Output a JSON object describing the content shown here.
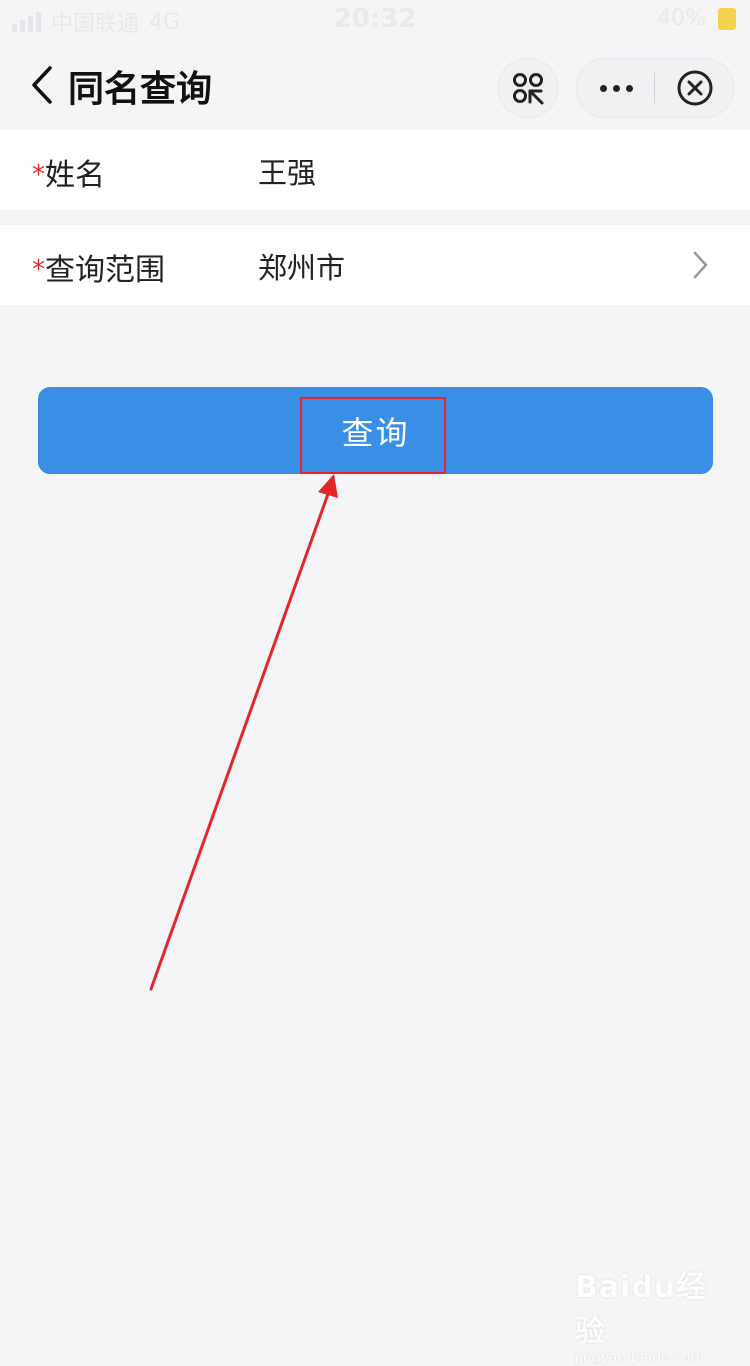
{
  "status_bar": {
    "carrier": "中国联通",
    "network": "4G",
    "time": "20:32",
    "battery": "40%"
  },
  "nav": {
    "title": "同名查询"
  },
  "form": {
    "required_mark": "*",
    "name_label": "姓名",
    "name_value": "王强",
    "range_label": "查询范围",
    "range_value": "郑州市"
  },
  "query_button": {
    "label": "查询"
  },
  "watermark": {
    "logo": "Baidu经验",
    "url": "jingyan.baidu.com"
  },
  "colors": {
    "primary": "#3a8ee6",
    "required": "#e02e2e",
    "annotation": "#e3262a"
  }
}
